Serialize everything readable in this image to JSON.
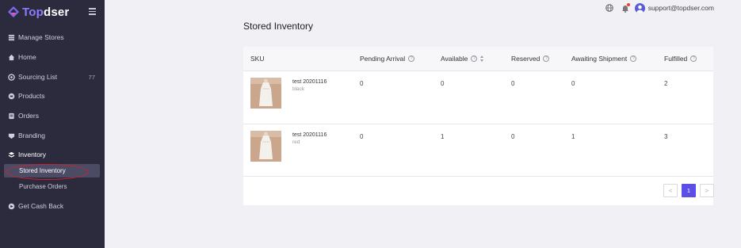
{
  "brand": {
    "top": "Top",
    "dser": "dser",
    "accent": "#8b7dff"
  },
  "sidebar": {
    "items": [
      {
        "label": "Manage Stores",
        "icon": "stack-icon"
      },
      {
        "label": "Home",
        "icon": "home-icon"
      },
      {
        "label": "Sourcing List",
        "icon": "sourcing-icon",
        "count": "77"
      },
      {
        "label": "Products",
        "icon": "tag-icon"
      },
      {
        "label": "Orders",
        "icon": "orders-icon"
      },
      {
        "label": "Branding",
        "icon": "branding-icon"
      },
      {
        "label": "Inventory",
        "icon": "inventory-icon"
      },
      {
        "label": "Get Cash Back",
        "icon": "cashback-icon"
      }
    ],
    "inventory_sub": [
      {
        "label": "Stored Inventory",
        "selected": true
      },
      {
        "label": "Purchase Orders",
        "selected": false
      }
    ]
  },
  "header": {
    "user_email": "support@topdser.com"
  },
  "page": {
    "title": "Stored Inventory"
  },
  "table": {
    "columns": [
      "SKU",
      "Pending Arrival",
      "Available",
      "Reserved",
      "Awaiting Shipment",
      "Fulfilled"
    ],
    "rows": [
      {
        "sku_name": "test 20201116",
        "variant": "black",
        "pending": "0",
        "available": "0",
        "reserved": "0",
        "awaiting": "0",
        "fulfilled": "2"
      },
      {
        "sku_name": "test 20201116",
        "variant": "red",
        "pending": "0",
        "available": "1",
        "reserved": "0",
        "awaiting": "1",
        "fulfilled": "3"
      }
    ]
  },
  "pagination": {
    "prev": "<",
    "current": "1",
    "next": ">"
  },
  "colors": {
    "sidebar_bg": "#2b2b3d",
    "primary": "#5b4fe8",
    "annotation": "#d0202a"
  }
}
